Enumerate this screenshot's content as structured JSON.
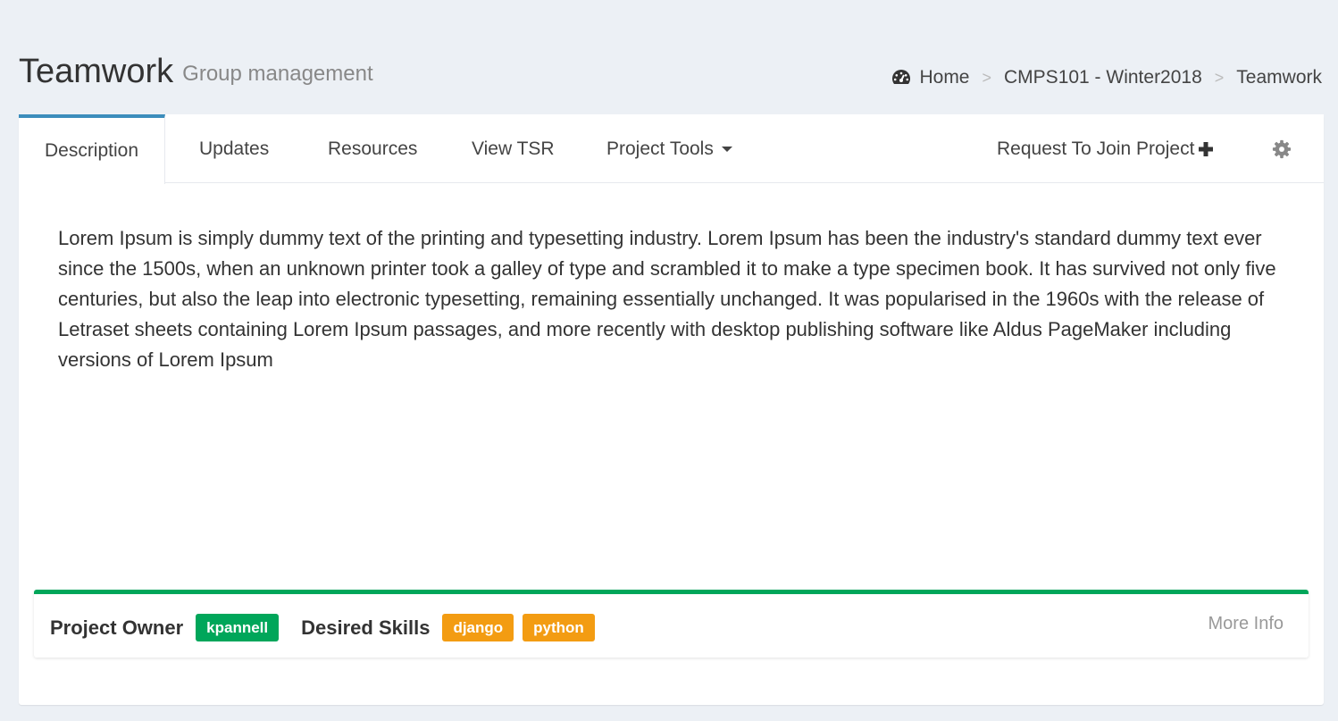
{
  "header": {
    "title": "Teamwork",
    "subtitle": "Group management"
  },
  "breadcrumb": {
    "icon": "dashboard-icon",
    "items": [
      "Home",
      "CMPS101 - Winter2018",
      "Teamwork"
    ],
    "separator": ">"
  },
  "tabs": {
    "items": [
      "Description",
      "Updates",
      "Resources",
      "View TSR",
      "Project Tools"
    ],
    "active": "Description",
    "request_join_label": "Request To Join Project"
  },
  "description": "Lorem Ipsum is simply dummy text of the printing and typesetting industry. Lorem Ipsum has been the industry's standard dummy text ever since the 1500s, when an unknown printer took a galley of type and scrambled it to make a type specimen book. It has survived not only five centuries, but also the leap into electronic typesetting, remaining essentially unchanged. It was popularised in the 1960s with the release of Letraset sheets containing Lorem Ipsum passages, and more recently with desktop publishing software like Aldus PageMaker including versions of Lorem Ipsum",
  "info": {
    "owner_label": "Project Owner",
    "owner": "kpannell",
    "skills_label": "Desired Skills",
    "skills": [
      "django",
      "python"
    ],
    "more_info": "More Info"
  },
  "colors": {
    "accent": "#3c8dbc",
    "success": "#00a65a",
    "warning": "#f39c12",
    "background": "#ecf0f5"
  }
}
